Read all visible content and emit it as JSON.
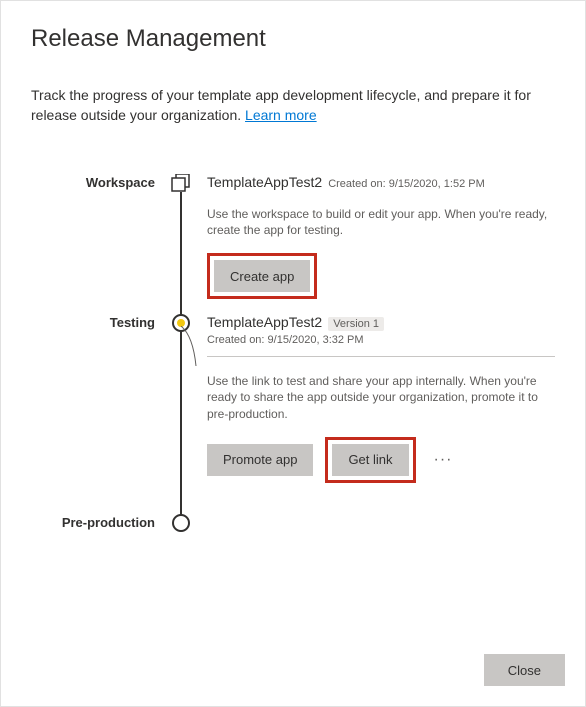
{
  "title": "Release Management",
  "description_pre": "Track the progress of your template app development lifecycle, and prepare it for release outside your organization. ",
  "learn_more": "Learn more",
  "stages": {
    "workspace": {
      "label": "Workspace",
      "app_name": "TemplateAppTest2",
      "created_on": "Created on: 9/15/2020, 1:52 PM",
      "desc": "Use the workspace to build or edit your app. When you're ready, create the app for testing.",
      "create_btn": "Create app"
    },
    "testing": {
      "label": "Testing",
      "app_name": "TemplateAppTest2",
      "version": "Version 1",
      "created_on": "Created on: 9/15/2020, 3:32 PM",
      "desc": "Use the link to test and share your app internally. When you're ready to share the app outside your organization, promote it to pre-production.",
      "promote_btn": "Promote app",
      "getlink_btn": "Get link",
      "more": "···"
    },
    "preprod": {
      "label": "Pre-production"
    }
  },
  "close_btn": "Close"
}
